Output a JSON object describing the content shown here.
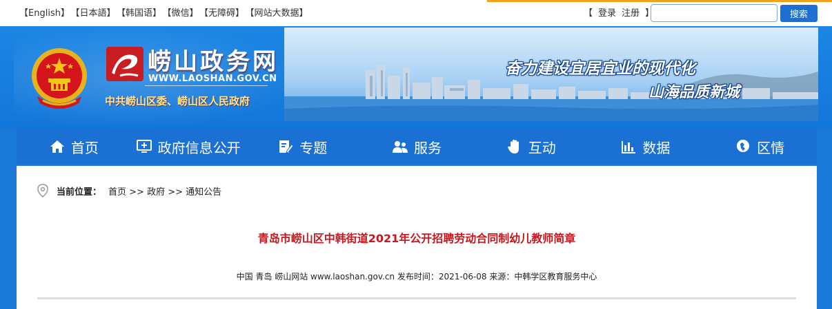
{
  "topbar": {
    "languages": [
      "【English】",
      "【日本語】",
      "【韩国语】",
      "【微信】",
      "【无障碍】",
      "【网站大数据】"
    ],
    "login_open": "【",
    "login_label": "登录",
    "register_label": "注册",
    "login_close": "】",
    "search_placeholder": "",
    "search_button": "搜索"
  },
  "header": {
    "site_name": "崂山政务网",
    "site_url": "WWW.LAOSHAN.GOV.CN",
    "site_subtitle": "中共崂山区委、崂山区人民政府",
    "slogan_line1": "奋力建设宜居宜业的现代化",
    "slogan_line2": "山海品质新城"
  },
  "nav": {
    "items": [
      {
        "label": "首页",
        "icon": "home-icon"
      },
      {
        "label": "政府信息公开",
        "icon": "monitor-icon"
      },
      {
        "label": "专题",
        "icon": "edit-icon"
      },
      {
        "label": "服务",
        "icon": "users-icon"
      },
      {
        "label": "互动",
        "icon": "hand-icon"
      },
      {
        "label": "数据",
        "icon": "bar-chart-icon"
      },
      {
        "label": "区情",
        "icon": "map-pin-icon"
      }
    ]
  },
  "breadcrumb": {
    "label": "当前位置：",
    "path": "首页 >> 政府 >> 通知公告"
  },
  "article": {
    "title": "青岛市崂山区中韩街道2021年公开招聘劳动合同制幼儿教师简章",
    "meta": "中国 青岛 崂山网站 www.laoshan.gov.cn 发布时间：2021-06-08 来源：中韩学区教育服务中心"
  },
  "colors": {
    "brand_blue": "#1a70d3",
    "title_red": "#c8161d",
    "accent_orange": "#f0a21a"
  }
}
